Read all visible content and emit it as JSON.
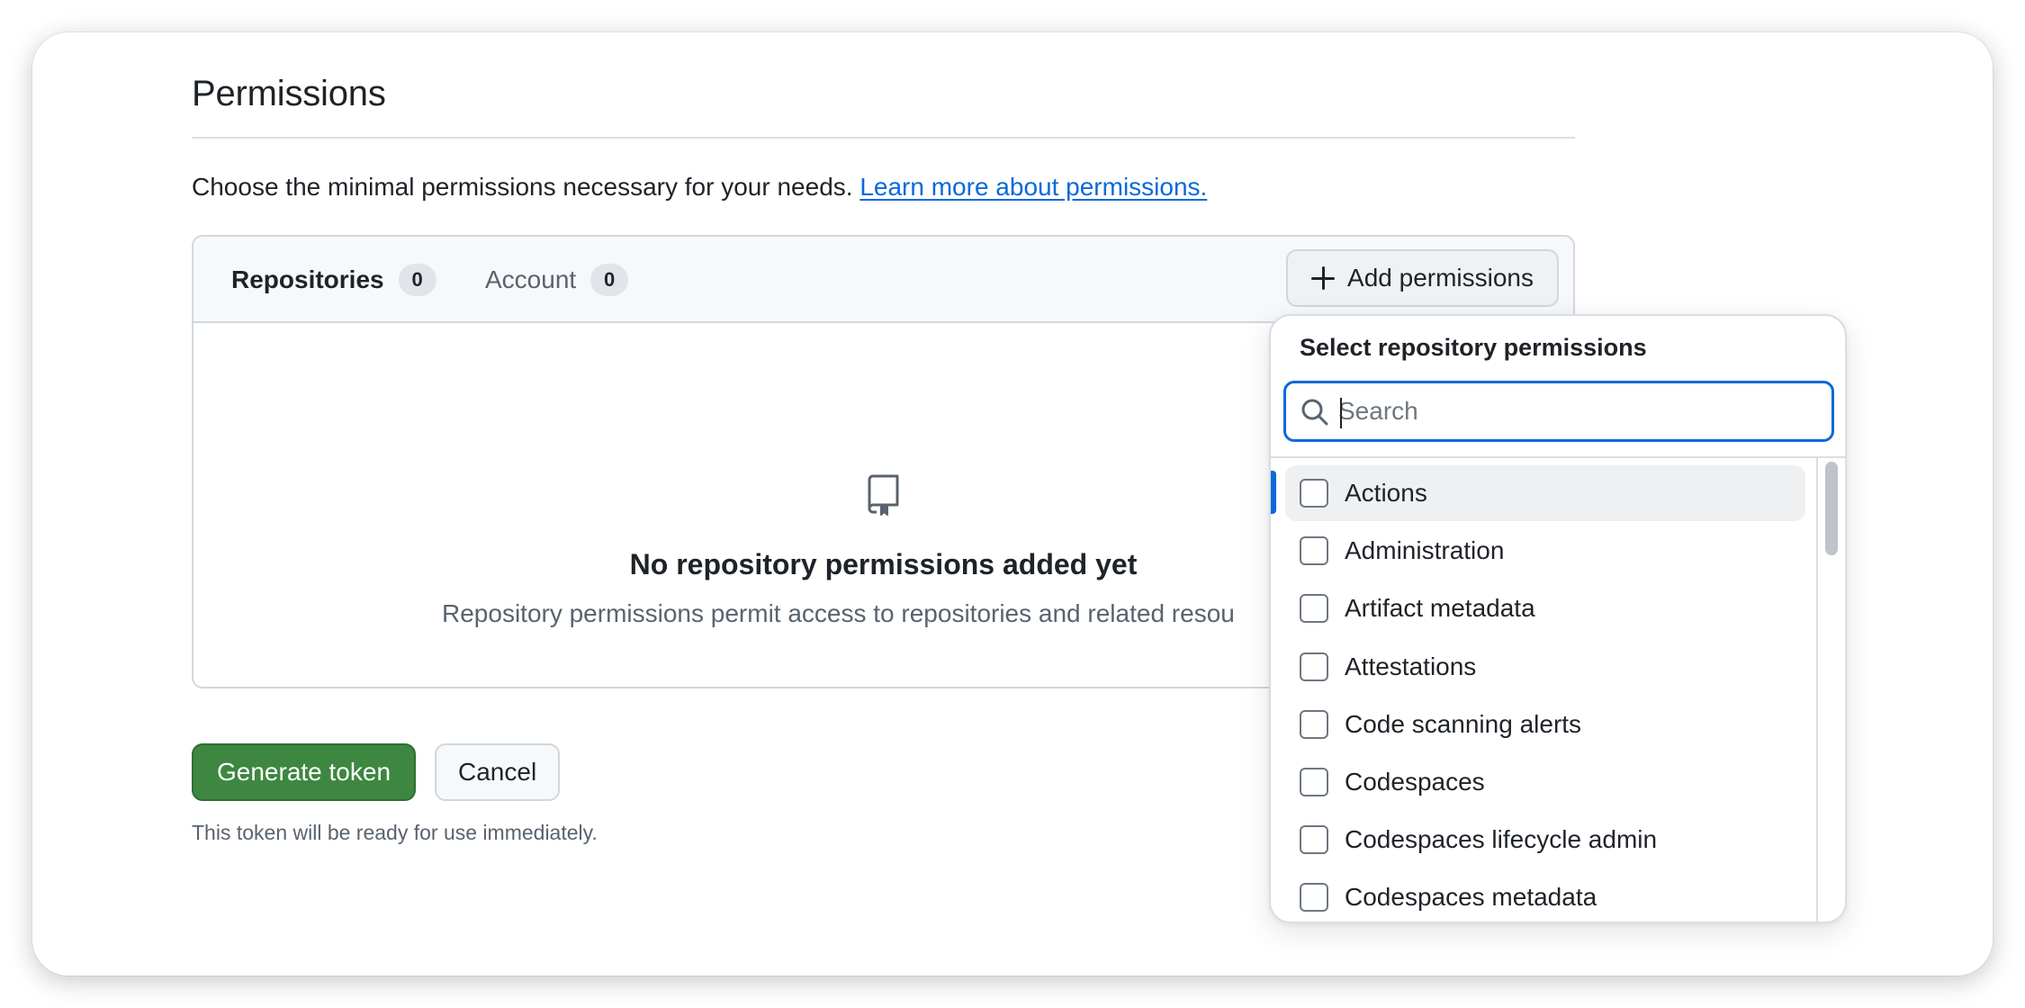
{
  "section": {
    "title": "Permissions",
    "description": "Choose the minimal permissions necessary for your needs.",
    "learn_more": "Learn more about permissions."
  },
  "tabs": [
    {
      "label": "Repositories",
      "count": "0"
    },
    {
      "label": "Account",
      "count": "0"
    }
  ],
  "add_permissions_label": "Add permissions",
  "empty_state": {
    "icon": "repo-icon",
    "title": "No repository permissions added yet",
    "description": "Repository permissions permit access to repositories and related resou"
  },
  "actions": {
    "generate": "Generate token",
    "cancel": "Cancel",
    "hint": "This token will be ready for use immediately."
  },
  "dropdown": {
    "title": "Select repository permissions",
    "search_placeholder": "Search",
    "items": [
      "Actions",
      "Administration",
      "Artifact metadata",
      "Attestations",
      "Code scanning alerts",
      "Codespaces",
      "Codespaces lifecycle admin",
      "Codespaces metadata"
    ],
    "active_index": 0
  },
  "colors": {
    "accent": "#0969da",
    "primary_button": "#3d8741"
  }
}
